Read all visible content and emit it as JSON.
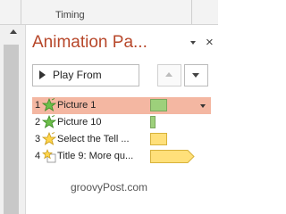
{
  "ribbon": {
    "group_label": "Timing"
  },
  "pane": {
    "title": "Animation Pa...",
    "close_glyph": "×",
    "play_label": "Play From",
    "items": [
      {
        "num": "1",
        "label": "Picture 1",
        "effect_icon": "entrance-star-icon",
        "bar_color": "#9dd07b",
        "selected": true
      },
      {
        "num": "2",
        "label": "Picture 10",
        "effect_icon": "entrance-star-icon",
        "bar_color": "#9dd07b",
        "selected": false
      },
      {
        "num": "3",
        "label": "Select the Tell ...",
        "effect_icon": "emphasis-star-icon",
        "bar_color": "#ffe07a",
        "selected": false
      },
      {
        "num": "4",
        "label": "Title 9: More qu...",
        "effect_icon": "emphasis-star-icon",
        "bar_color": "#ffe07a",
        "selected": false
      }
    ]
  },
  "watermark": "groovyPost.com"
}
